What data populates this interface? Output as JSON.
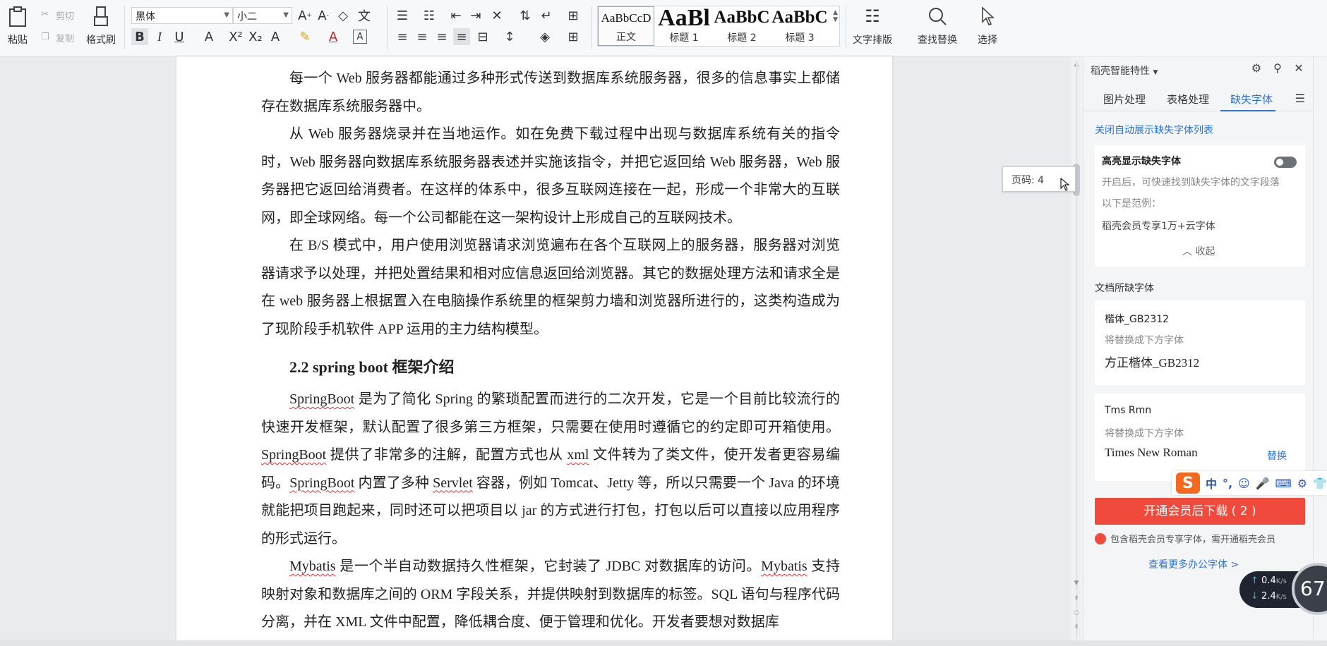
{
  "ribbon": {
    "paste_label": "粘贴",
    "cut_label": "剪切",
    "copy_label": "复制",
    "format_painter_label": "格式刷",
    "font_name": "黑体",
    "font_size": "小二",
    "styles": [
      {
        "sample": "AaBbCcD",
        "name": "正文"
      },
      {
        "sample": "AaBl",
        "name": "标题 1"
      },
      {
        "sample": "AaBbC",
        "name": "标题 2"
      },
      {
        "sample": "AaBbC",
        "name": "标题 3"
      }
    ],
    "text_layout_label": "文字排版",
    "find_replace_label": "查找替换",
    "select_label": "选择"
  },
  "document": {
    "p1": "每一个 Web 服务器都能通过多种形式传送到数据库系统服务器，很多的信息事实上都储存在数据库系统服务器中。",
    "p2": "从 Web 服务器烧录并在当地运作。如在免费下载过程中出现与数据库系统有关的指令时，Web 服务器向数据库系统服务器表述并实施该指令，并把它返回给 Web 服务器，Web 服务器把它返回给消费者。在这样的体系中，很多互联网连接在一起，形成一个非常大的互联网，即全球网络。每一个公司都能在这一架构设计上形成自己的互联网技术。",
    "p3": "在 B/S 模式中，用户使用浏览器请求浏览遍布在各个互联网上的服务器，服务器对浏览器请求予以处理，并把处置结果和相对应信息返回给浏览器。其它的数据处理方法和请求全是在 web 服务器上根据置入在电脑操作系统里的框架剪力墙和浏览器所进行的，这类构造成为了现阶段手机软件 APP 运用的主力结构模型。",
    "heading": "2.2 spring boot 框架介绍",
    "p4a": "SpringBoot",
    "p4b": " 是为了简化 Spring 的繁琐配置而进行的二次开发，它是一个目前比较流行的快速开发框架，默认配置了很多第三方框架，只需要在使用时遵循它的约定即可开箱使用。",
    "p4c": "SpringBoot",
    "p4d": " 提供了非常多的注解，配置方式也从 ",
    "p4e": "xml",
    "p4f": " 文件转为了类文件，使开发者更容易编码。",
    "p4g": "SpringBoot",
    "p4h": " 内置了多种 ",
    "p4i": "Servlet",
    "p4j": " 容器，例如 Tomcat、Jetty 等，所以只需要一个 Java 的环境就能把项目跑起来，同时还可以把项目以 jar 的方式进行打包，打包以后可以直接以应用程序的形式运行。",
    "p5a": "Mybatis",
    "p5b": " 是一个半自动数据持久性框架，它封装了 JDBC 对数据库的访问。",
    "p5c": "Mybatis",
    "p5d": " 支持映射对象和数据库之间的 ORM 字段关系，并提供映射到数据库的标签。SQL 语句与程序代码分离，并在 XML 文件中配置，降低耦合度、便于管理和优化。开发者要想对数据库"
  },
  "tooltip": "页码: 4",
  "panel": {
    "title": "稻壳智能特性",
    "tabs": [
      "图片处理",
      "表格处理",
      "缺失字体"
    ],
    "close_auto_link": "关闭自动展示缺失字体列表",
    "highlight_title": "高亮显示缺失字体",
    "highlight_desc": "开启后，可快速找到缺失字体的文字段落",
    "example_label": "以下是范例：",
    "example_text": "稻壳会员专享1万+云字体",
    "collapse_label": "收起",
    "missing_section": "文档所缺字体",
    "font1_name": "楷体_GB2312",
    "font1_hint": "将替换成下方字体",
    "font1_replacement": "方正楷体_GB2312",
    "font2_name": "Tms Rmn",
    "font2_hint": "将替换成下方字体",
    "font2_replacement": "Times New Roman",
    "replace_link": "替换",
    "download_button": "开通会员后下载 ( 2 )",
    "vip_note": "包含稻壳会员专享字体，需开通稻壳会员",
    "more_fonts_link": "查看更多办公字体 >"
  },
  "ime": {
    "items": [
      "中",
      "°,"
    ]
  },
  "net": {
    "up": "0.4",
    "down": "2.4",
    "unit": "K/s",
    "gauge": "67"
  }
}
